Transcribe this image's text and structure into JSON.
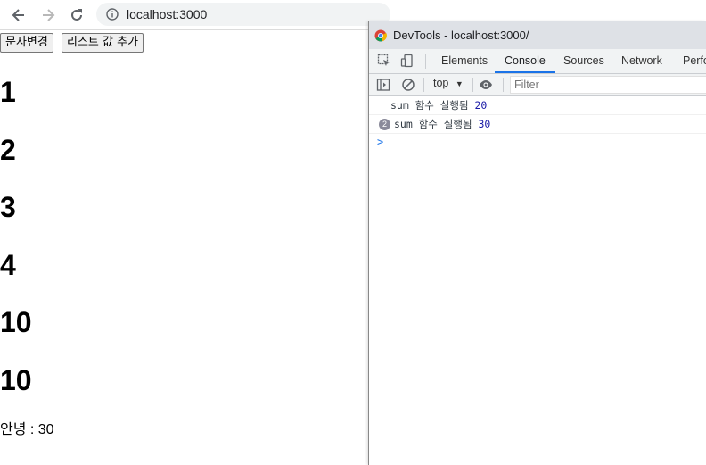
{
  "browser": {
    "url": "localhost:3000",
    "back_icon": "arrow-left-icon",
    "forward_icon": "arrow-right-icon",
    "reload_icon": "reload-icon"
  },
  "page": {
    "buttons": [
      "문자변경",
      "리스트 값 추가"
    ],
    "numbers": [
      "1",
      "2",
      "3",
      "4",
      "10",
      "10"
    ],
    "greeting": "안녕 : 30"
  },
  "devtools": {
    "title": "DevTools - localhost:3000/",
    "tabs": [
      "Elements",
      "Console",
      "Sources",
      "Network",
      "Perfo"
    ],
    "active_tab": "Console",
    "context": "top",
    "filter_placeholder": "Filter",
    "logs": [
      {
        "text": "sum 함수 실행됨",
        "value": "20",
        "count": ""
      },
      {
        "text": "sum 함수 실행됨",
        "value": "30",
        "count": "2"
      }
    ],
    "prompt_symbol": ">"
  },
  "colors": {
    "accent": "#1a73e8",
    "log_value": "#1a1aa6"
  }
}
